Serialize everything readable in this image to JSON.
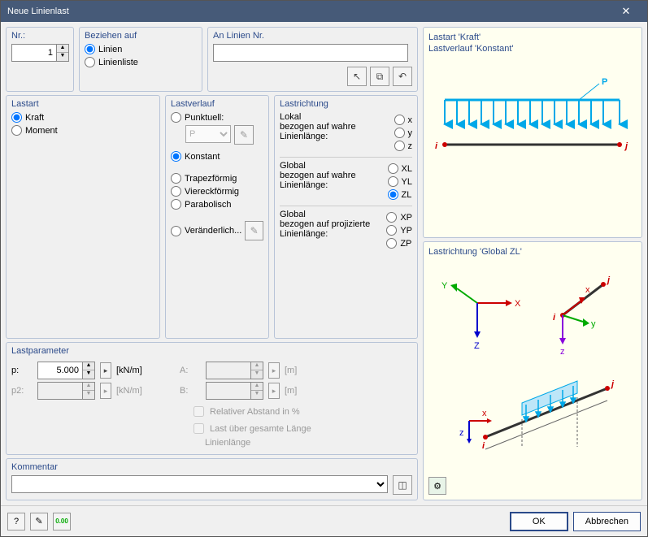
{
  "window": {
    "title": "Neue Linienlast"
  },
  "nr": {
    "title": "Nr.:",
    "value": "1"
  },
  "beziehen": {
    "title": "Beziehen auf",
    "linien": "Linien",
    "linienliste": "Linienliste"
  },
  "anlinien": {
    "title": "An Linien Nr.",
    "value": ""
  },
  "lastart": {
    "title": "Lastart",
    "kraft": "Kraft",
    "moment": "Moment"
  },
  "lastverlauf": {
    "title": "Lastverlauf",
    "punktuell": "Punktuell:",
    "punktuell_sel": "P",
    "konstant": "Konstant",
    "trapez": "Trapezförmig",
    "viereck": "Viereckförmig",
    "parabolisch": "Parabolisch",
    "veraenderlich": "Veränderlich..."
  },
  "lastrichtung": {
    "title": "Lastrichtung",
    "lokal_t": "Lokal",
    "lokal_s": "bezogen auf wahre Linienlänge:",
    "x": "x",
    "y": "y",
    "z": "z",
    "global1_t": "Global",
    "global1_s": "bezogen auf wahre Linienlänge:",
    "XL": "XL",
    "YL": "YL",
    "ZL": "ZL",
    "global2_t": "Global",
    "global2_s": "bezogen auf projizierte Linienlänge:",
    "XP": "XP",
    "YP": "YP",
    "ZP": "ZP"
  },
  "lastparam": {
    "title": "Lastparameter",
    "p_lbl": "p:",
    "p_val": "5.000",
    "p_unit": "[kN/m]",
    "p2_lbl": "p2:",
    "p2_val": "",
    "p2_unit": "[kN/m]",
    "a_lbl": "A:",
    "a_val": "",
    "a_unit": "[m]",
    "b_lbl": "B:",
    "b_val": "",
    "b_unit": "[m]",
    "rel": "Relativer Abstand in %",
    "ganz": "Last über gesamte Länge",
    "ganz2": "Linienlänge"
  },
  "kommentar": {
    "title": "Kommentar"
  },
  "preview_top": {
    "line1": "Lastart 'Kraft'",
    "line2": "Lastverlauf 'Konstant'",
    "P": "P",
    "i": "i",
    "j": "j"
  },
  "preview_bottom": {
    "title": "Lastrichtung 'Global ZL'",
    "X": "X",
    "Y": "Y",
    "Z": "Z",
    "x": "x",
    "y": "y",
    "z": "z",
    "i": "i",
    "j": "j"
  },
  "footer": {
    "ok": "OK",
    "cancel": "Abbrechen"
  }
}
